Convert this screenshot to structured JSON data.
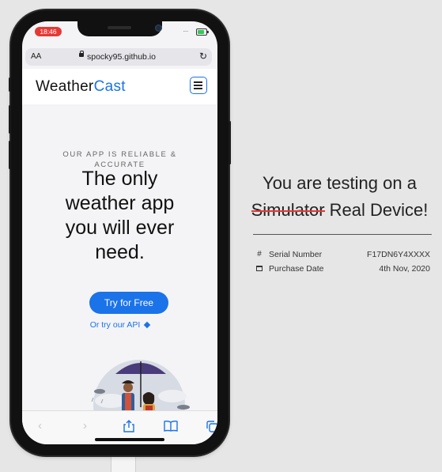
{
  "status_bar": {
    "time": "18:46"
  },
  "browser": {
    "text_size": "AA",
    "url": "spocky95.github.io"
  },
  "site": {
    "brand_prefix": "Weather",
    "brand_accent": "Cast",
    "eyebrow_line1": "OUR APP IS RELIABLE &",
    "eyebrow_line2": "ACCURATE",
    "headline_line1": "The only",
    "headline_line2": "weather app",
    "headline_line3": "you will ever",
    "headline_line4": "need.",
    "cta_label": "Try for Free",
    "api_link": "Or try our API"
  },
  "device_info": {
    "heading_line1": "You are testing on a",
    "struck_word": "Simulator",
    "real_device": "Real Device!",
    "rows": [
      {
        "icon": "#",
        "label": "Serial Number",
        "value": "F17DN6Y4XXXX"
      },
      {
        "icon": "calendar",
        "label": "Purchase Date",
        "value": "4th Nov, 2020"
      }
    ]
  },
  "colors": {
    "accent": "#1a73e8",
    "record_pill": "#e53935",
    "strike": "#e53935"
  }
}
